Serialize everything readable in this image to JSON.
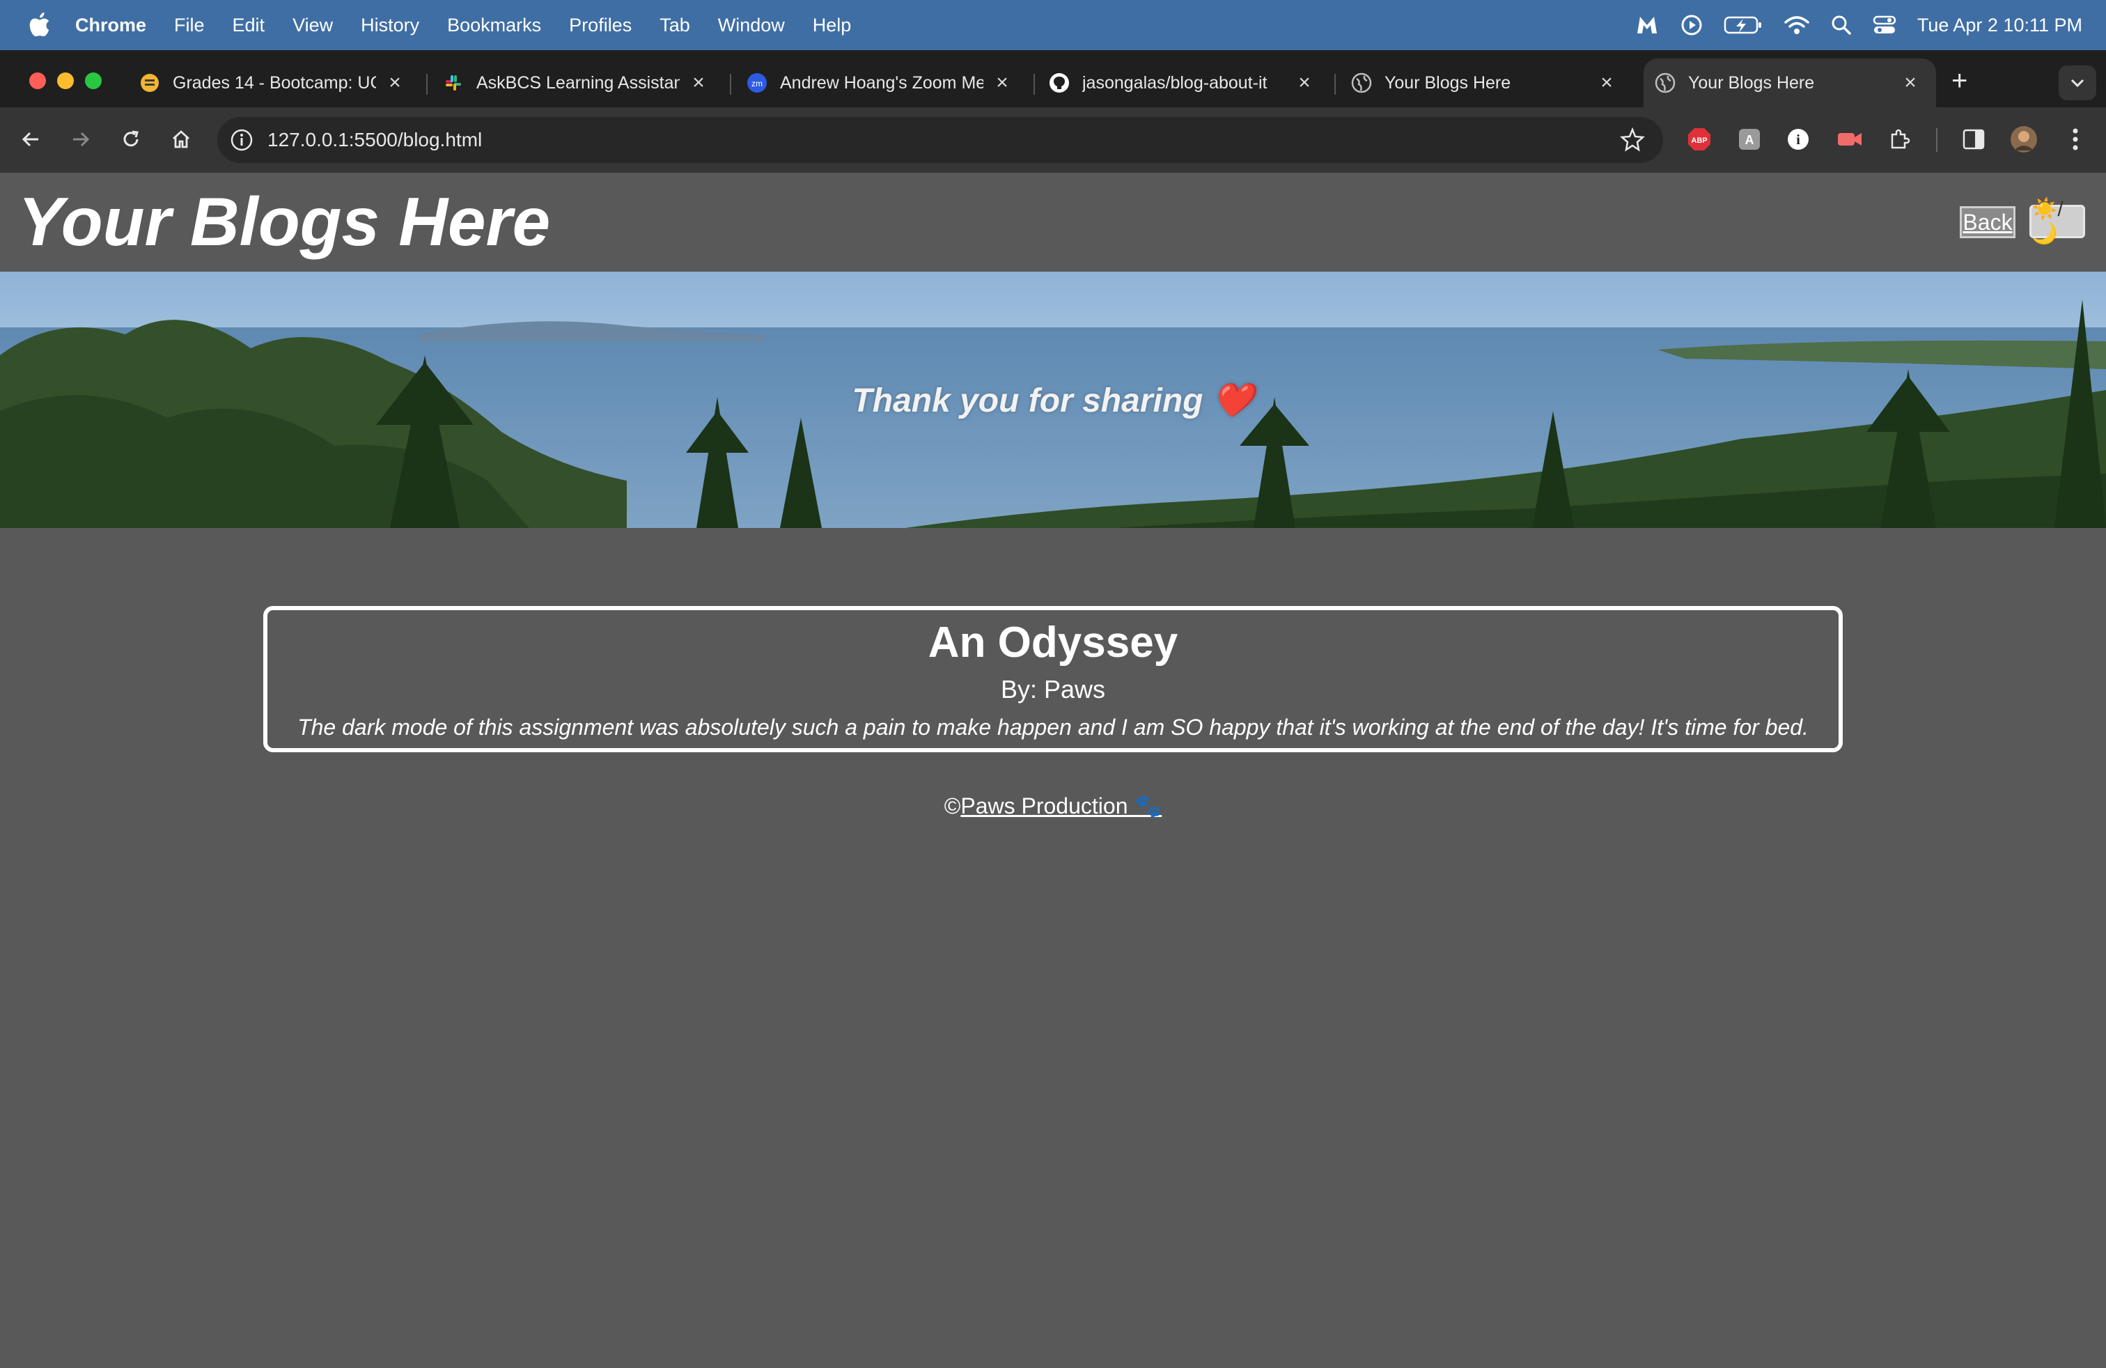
{
  "menubar": {
    "app_name": "Chrome",
    "items": [
      "File",
      "Edit",
      "View",
      "History",
      "Bookmarks",
      "Profiles",
      "Tab",
      "Window",
      "Help"
    ],
    "clock": "Tue Apr 2  10:11 PM"
  },
  "tabs": [
    {
      "title": "Grades 14 - Bootcamp: UC",
      "icon": "gradebook-icon"
    },
    {
      "title": "AskBCS Learning Assistant",
      "icon": "slack-icon"
    },
    {
      "title": "Andrew Hoang's Zoom Meeting",
      "icon": "zoom-icon"
    },
    {
      "title": "jasongalas/blog-about-it",
      "icon": "github-icon"
    },
    {
      "title": "Your Blogs Here",
      "icon": "globe-icon"
    },
    {
      "title": "Your Blogs Here",
      "icon": "globe-icon"
    }
  ],
  "toolbar": {
    "url": "127.0.0.1:5500/blog.html",
    "extensions": [
      "abp-icon",
      "translate-icon",
      "info-circle-icon",
      "record-icon",
      "puzzle-icon",
      "sidepanel-icon",
      "profile-avatar-icon",
      "more-icon"
    ]
  },
  "page": {
    "title": "Your Blogs Here",
    "back_label": "Back",
    "mode_toggle_label": "☀️/🌙",
    "hero_text": "Thank you for sharing ❤️",
    "post": {
      "title": "An Odyssey",
      "author": "By: Paws",
      "content": "The dark mode of this assignment was absolutely such a pain to make happen and I am SO happy that it's working at the end of the day! It's time for bed."
    },
    "footer_prefix": "©",
    "footer_link": "Paws Production 🐾"
  },
  "colors": {
    "menubar": "#3f6ea4",
    "tabstrip": "#1f1f1f",
    "toolbar": "#353535",
    "page_bg": "#595959",
    "text": "#ffffff"
  }
}
